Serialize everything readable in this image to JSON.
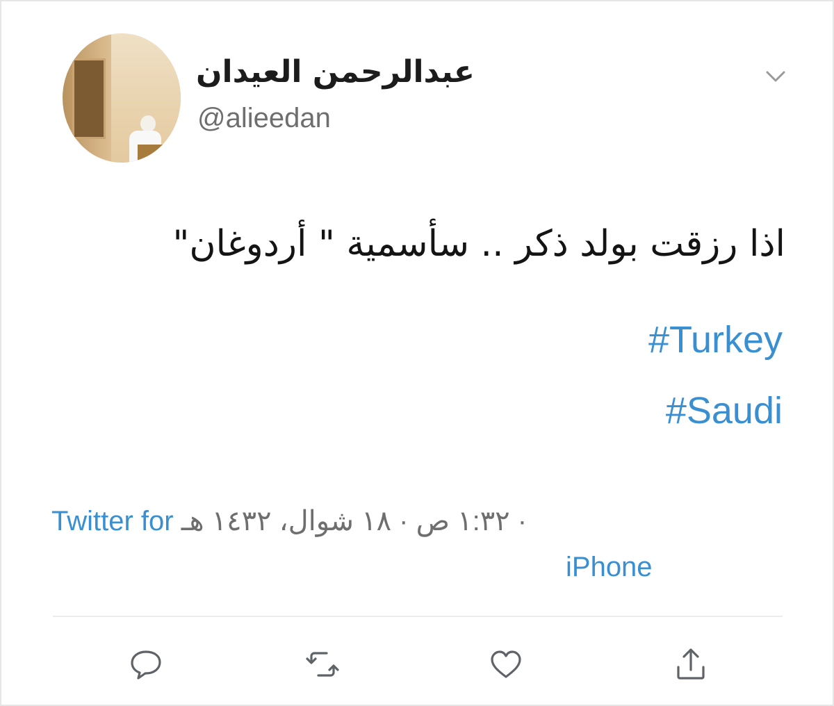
{
  "tweet": {
    "display_name": "عبدالرحمن العيدان",
    "handle": "@alieedan",
    "text": "اذا رزقت بولد ذكر .. سأسمية \" أردوغان\"",
    "hashtags": [
      "#Turkey",
      "#Saudi"
    ],
    "timestamp": "١:٣٢ ص · ١٨ شوال، ١٤٣٢ هـ ·",
    "source_part1": "Twitter for",
    "source_part2": "iPhone"
  },
  "icons": {
    "menu": "chevron-down-icon",
    "reply": "speech-bubble-icon",
    "retweet": "retweet-icon",
    "like": "heart-icon",
    "share": "share-icon"
  },
  "colors": {
    "link": "#3a8fd0",
    "text": "#141414",
    "muted": "#6e6e6e",
    "icon": "#5f6368"
  }
}
